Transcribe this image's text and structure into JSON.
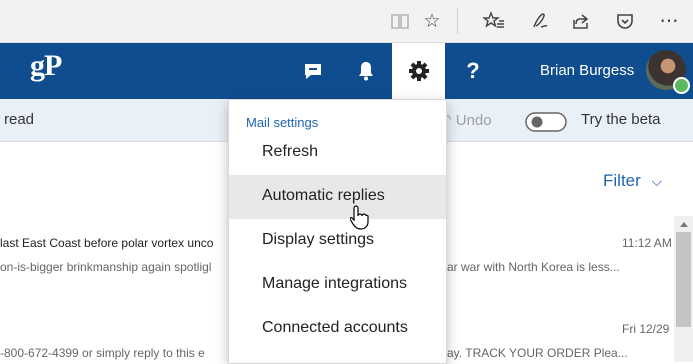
{
  "browser": {
    "icons": [
      "reading-view-icon",
      "favorite-star-icon",
      "favorites-hub-icon",
      "pen-icon",
      "share-icon",
      "pocket-icon",
      "more-icon"
    ]
  },
  "header": {
    "logo": "gP",
    "user_name": "Brian Burgess",
    "brand_color": "#0f4d8f"
  },
  "commandbar": {
    "mark_read": "read",
    "undo": "Undo",
    "beta": "Try the beta"
  },
  "maillist": {
    "filter": "Filter",
    "messages": [
      {
        "subject": "last East Coast before polar vortex unco",
        "preview": "on-is-bigger brinkmanship again spotligl",
        "preview_right": "ar war with North Korea is less...",
        "time": "11:12 AM"
      },
      {
        "subject": "",
        "preview": "-800-672-4399 or simply reply to this e",
        "preview_right": "ay. TRACK YOUR ORDER Plea...",
        "time": "Fri 12/29"
      }
    ]
  },
  "settings_menu": {
    "header": "Mail settings",
    "items": [
      "Refresh",
      "Automatic replies",
      "Display settings",
      "Manage integrations",
      "Connected accounts"
    ],
    "hovered_index": 1
  }
}
